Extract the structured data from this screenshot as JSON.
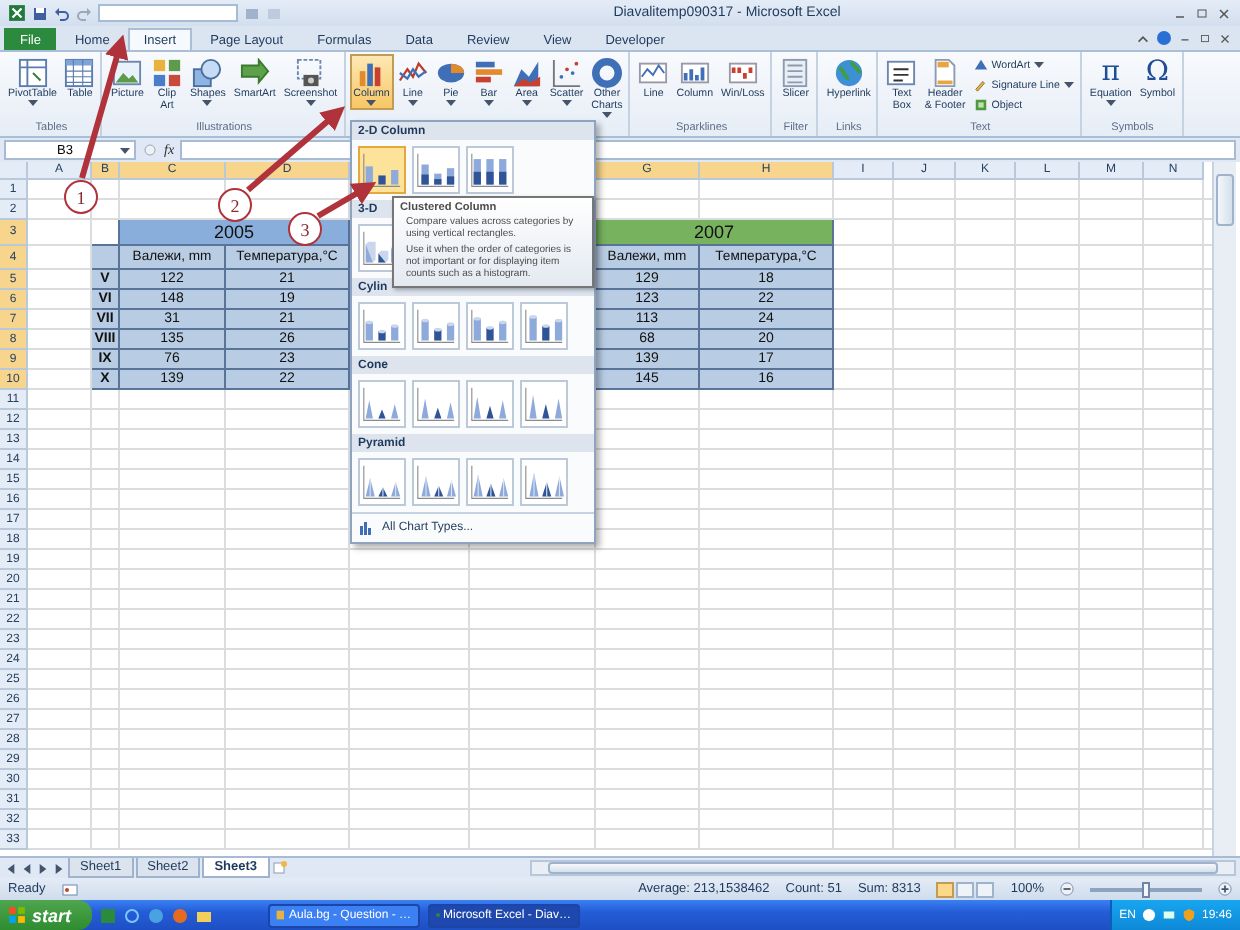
{
  "window": {
    "title": "Diavalitemp090317 - Microsoft Excel"
  },
  "tabs": [
    {
      "label": "File",
      "kind": "file",
      "selected": false
    },
    {
      "label": "Home",
      "kind": "tab",
      "selected": false
    },
    {
      "label": "Insert",
      "kind": "tab",
      "selected": true
    },
    {
      "label": "Page Layout",
      "kind": "tab",
      "selected": false
    },
    {
      "label": "Formulas",
      "kind": "tab",
      "selected": false
    },
    {
      "label": "Data",
      "kind": "tab",
      "selected": false
    },
    {
      "label": "Review",
      "kind": "tab",
      "selected": false
    },
    {
      "label": "View",
      "kind": "tab",
      "selected": false
    },
    {
      "label": "Developer",
      "kind": "tab",
      "selected": false
    }
  ],
  "ribbon": {
    "groups": [
      {
        "label": "Tables",
        "buttons": [
          {
            "kind": "large",
            "label": "PivotTable",
            "dropdown": true,
            "pressed": false
          },
          {
            "kind": "large",
            "label": "Table",
            "dropdown": false,
            "pressed": false
          }
        ]
      },
      {
        "label": "Illustrations",
        "buttons": [
          {
            "kind": "large",
            "label": "Picture",
            "dropdown": false,
            "pressed": false
          },
          {
            "kind": "large",
            "label": "Clip\nArt",
            "dropdown": false,
            "pressed": false
          },
          {
            "kind": "large",
            "label": "Shapes",
            "dropdown": true,
            "pressed": false
          },
          {
            "kind": "large",
            "label": "SmartArt",
            "dropdown": false,
            "pressed": false
          },
          {
            "kind": "large",
            "label": "Screenshot",
            "dropdown": true,
            "pressed": false
          }
        ]
      },
      {
        "buttons": [
          {
            "kind": "large",
            "label": "Column",
            "dropdown": true,
            "pressed": true
          },
          {
            "kind": "large",
            "label": "Line",
            "dropdown": true,
            "pressed": false
          },
          {
            "kind": "large",
            "label": "Pie",
            "dropdown": true,
            "pressed": false
          },
          {
            "kind": "large",
            "label": "Bar",
            "dropdown": true,
            "pressed": false
          },
          {
            "kind": "large",
            "label": "Area",
            "dropdown": true,
            "pressed": false
          },
          {
            "kind": "large",
            "label": "Scatter",
            "dropdown": true,
            "pressed": false
          },
          {
            "kind": "large",
            "label": "Other\nCharts",
            "dropdown": true,
            "pressed": false
          }
        ]
      },
      {
        "label": "Sparklines",
        "buttons": [
          {
            "kind": "large",
            "label": "Line",
            "dropdown": false,
            "pressed": false
          },
          {
            "kind": "large",
            "label": "Column",
            "dropdown": false,
            "pressed": false
          },
          {
            "kind": "large",
            "label": "Win/Loss",
            "dropdown": false,
            "pressed": false
          }
        ]
      },
      {
        "label": "Filter",
        "buttons": [
          {
            "kind": "large",
            "label": "Slicer",
            "dropdown": false,
            "pressed": false
          }
        ]
      },
      {
        "label": "Links",
        "buttons": [
          {
            "kind": "large",
            "label": "Hyperlink",
            "dropdown": false,
            "pressed": false
          }
        ]
      },
      {
        "label": "Text",
        "buttons": [
          {
            "kind": "large",
            "label": "Text\nBox",
            "dropdown": false,
            "pressed": false
          },
          {
            "kind": "large",
            "label": "Header\n& Footer",
            "dropdown": false,
            "pressed": false
          },
          {
            "kind": "small",
            "label": "WordArt",
            "dropdown": true
          },
          {
            "kind": "small",
            "label": "Signature Line",
            "dropdown": true
          },
          {
            "kind": "small",
            "label": "Object",
            "dropdown": false
          }
        ]
      },
      {
        "label": "Symbols",
        "buttons": [
          {
            "kind": "glyph",
            "glyph": "π",
            "label": "Equation",
            "dropdown": true,
            "pressed": false
          },
          {
            "kind": "glyph",
            "glyph": "Ω",
            "label": "Symbol",
            "dropdown": false,
            "pressed": false
          }
        ]
      }
    ]
  },
  "formula_bar": {
    "name_box": "B3",
    "fx_label": "fx"
  },
  "columns": [
    {
      "label": "A",
      "selected": false
    },
    {
      "label": "B",
      "selected": true
    },
    {
      "label": "C",
      "selected": true
    },
    {
      "label": "D",
      "selected": true
    },
    {
      "label": "G",
      "selected": true
    },
    {
      "label": "H",
      "selected": true
    },
    {
      "label": "I",
      "selected": false
    },
    {
      "label": "J",
      "selected": false
    },
    {
      "label": "K",
      "selected": false
    },
    {
      "label": "L",
      "selected": false
    },
    {
      "label": "M",
      "selected": false
    },
    {
      "label": "N",
      "selected": false
    }
  ],
  "rows": [
    {
      "label": "1",
      "selected": false
    },
    {
      "label": "2",
      "selected": false
    },
    {
      "label": "3",
      "selected": true
    },
    {
      "label": "4",
      "selected": true
    },
    {
      "label": "5",
      "selected": true
    },
    {
      "label": "6",
      "selected": true
    },
    {
      "label": "7",
      "selected": true
    },
    {
      "label": "8",
      "selected": true
    },
    {
      "label": "9",
      "selected": true
    },
    {
      "label": "10",
      "selected": true
    },
    {
      "label": "11",
      "selected": false
    },
    {
      "label": "12",
      "selected": false
    },
    {
      "label": "13",
      "selected": false
    },
    {
      "label": "14",
      "selected": false
    },
    {
      "label": "15",
      "selected": false
    },
    {
      "label": "16",
      "selected": false
    },
    {
      "label": "17",
      "selected": false
    },
    {
      "label": "18",
      "selected": false
    },
    {
      "label": "19",
      "selected": false
    },
    {
      "label": "20",
      "selected": false
    },
    {
      "label": "21",
      "selected": false
    },
    {
      "label": "22",
      "selected": false
    },
    {
      "label": "23",
      "selected": false
    },
    {
      "label": "24",
      "selected": false
    },
    {
      "label": "25",
      "selected": false
    },
    {
      "label": "26",
      "selected": false
    },
    {
      "label": "27",
      "selected": false
    },
    {
      "label": "28",
      "selected": false
    },
    {
      "label": "29",
      "selected": false
    },
    {
      "label": "30",
      "selected": false
    },
    {
      "label": "31",
      "selected": false
    },
    {
      "label": "32",
      "selected": false
    },
    {
      "label": "33",
      "selected": false
    }
  ],
  "table": {
    "years": [
      {
        "label": "2005",
        "color": "#8aaedb"
      },
      {
        "label": "2007",
        "color": "#77b25e"
      }
    ],
    "headers": [
      "Валежи, mm",
      "Температура,°C",
      "Валежи, mm",
      "Температура,°C"
    ],
    "rows": [
      {
        "month": "V",
        "values": [
          "122",
          "21",
          "129",
          "18"
        ]
      },
      {
        "month": "VI",
        "values": [
          "148",
          "19",
          "123",
          "22"
        ]
      },
      {
        "month": "VII",
        "values": [
          "31",
          "21",
          "113",
          "24"
        ]
      },
      {
        "month": "VIII",
        "values": [
          "135",
          "26",
          "68",
          "20"
        ]
      },
      {
        "month": "IX",
        "values": [
          "76",
          "23",
          "139",
          "17"
        ]
      },
      {
        "month": "X",
        "values": [
          "139",
          "22",
          "145",
          "16"
        ]
      }
    ]
  },
  "gallery": {
    "sections": [
      {
        "title": "2-D Column",
        "kind": "column",
        "items": [
          {
            "selected": true
          },
          {
            "selected": false
          },
          {
            "selected": false
          }
        ]
      },
      {
        "title": "3-D",
        "kind": "column3d",
        "items": [
          {
            "selected": false
          }
        ]
      },
      {
        "title": "Cylin",
        "kind": "cylinder",
        "items": [
          {
            "selected": false
          },
          {
            "selected": false
          },
          {
            "selected": false
          },
          {
            "selected": false
          }
        ]
      },
      {
        "title": "Cone",
        "kind": "cone",
        "items": [
          {
            "selected": false
          },
          {
            "selected": false
          },
          {
            "selected": false
          },
          {
            "selected": false
          }
        ]
      },
      {
        "title": "Pyramid",
        "kind": "pyramid",
        "items": [
          {
            "selected": false
          },
          {
            "selected": false
          },
          {
            "selected": false
          },
          {
            "selected": false
          }
        ]
      }
    ],
    "footer": "All Chart Types..."
  },
  "tooltip": {
    "title": "Clustered Column",
    "paragraphs": [
      "Compare values across categories by using vertical rectangles.",
      "Use it when the order of categories is not important or for displaying item counts such as a histogram."
    ]
  },
  "annotations": [
    {
      "label": "1"
    },
    {
      "label": "2"
    },
    {
      "label": "3"
    }
  ],
  "sheets": [
    {
      "label": "Sheet1",
      "selected": false
    },
    {
      "label": "Sheet2",
      "selected": false
    },
    {
      "label": "Sheet3",
      "selected": true
    }
  ],
  "status_bar": {
    "mode": "Ready",
    "stats": [
      "Average: 213,1538462",
      "Count: 51",
      "Sum: 8313"
    ],
    "views": [
      {
        "selected": true
      },
      {
        "selected": false
      },
      {
        "selected": false
      }
    ],
    "zoom": "100%",
    "zoom_level": {
      "level": 0.5
    }
  },
  "taskbar": {
    "start": "start",
    "tasks": [
      {
        "label": "Aula.bg - Question - …",
        "selected": false
      },
      {
        "label": "Microsoft Excel - Diav…",
        "selected": true
      }
    ],
    "language": "EN",
    "clock": "19:46"
  }
}
